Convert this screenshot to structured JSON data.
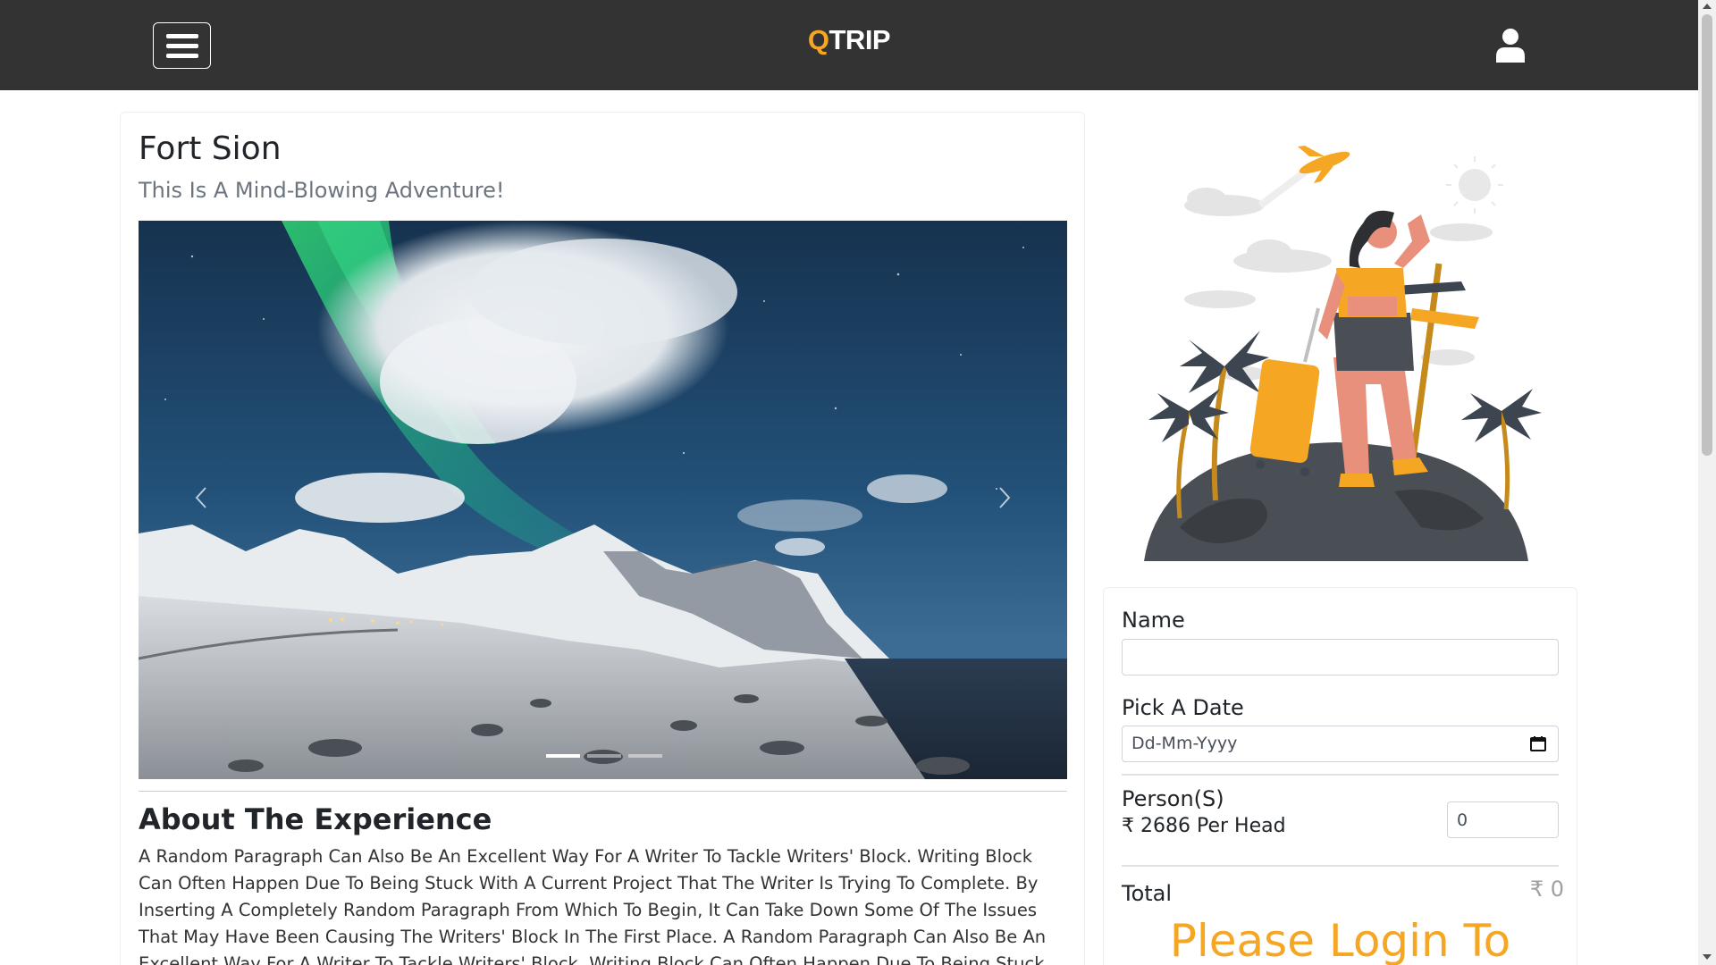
{
  "nav": {
    "brand_q": "Q",
    "brand_rest": "TRIP",
    "menu_icon": "hamburger-menu-icon",
    "user_icon": "user-icon"
  },
  "adventure": {
    "name": "Fort Sion",
    "subtitle": "This Is A Mind-Blowing Adventure!",
    "carousel": {
      "prev_icon": "chevron-left-icon",
      "next_icon": "chevron-right-icon",
      "slide_count": 3,
      "active_slide": 1
    },
    "about_title": "About The Experience",
    "about_text": "A Random Paragraph Can Also Be An Excellent Way For A Writer To Tackle Writers' Block. Writing Block Can Often Happen Due To Being Stuck With A Current Project That The Writer Is Trying To Complete. By Inserting A Completely Random Paragraph From Which To Begin, It Can Take Down Some Of The Issues That May Have Been Causing The Writers' Block In The First Place. A Random Paragraph Can Also Be An Excellent Way For A Writer To Tackle Writers' Block. Writing Block Can Often Happen Due To Being Stuck With A Current Project That The Writer Is Trying To Complete."
  },
  "reservation": {
    "name_label": "Name",
    "name_value": "",
    "date_label": "Pick A Date",
    "date_placeholder": "Dd-Mm-Yyyy",
    "date_icon": "calendar-icon",
    "persons_label": "Person(S)",
    "persons_value": "0",
    "price_text": "₹ 2686 Per Head",
    "total_label": "Total",
    "total_value": "₹ 0",
    "login_message": "Please Login To"
  },
  "colors": {
    "accent": "#f5a623",
    "nav_bg": "#333333"
  }
}
